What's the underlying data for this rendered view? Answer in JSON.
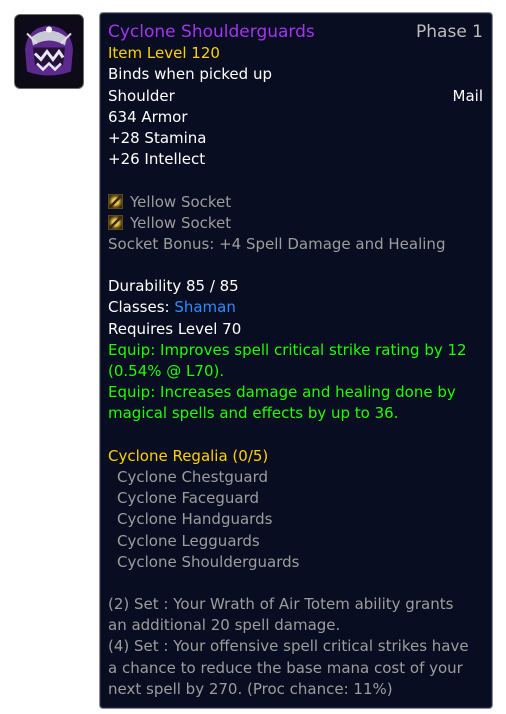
{
  "item": {
    "icon": "purple-helm-shoulder-icon",
    "name": "Cyclone Shoulderguards",
    "phase": "Phase 1",
    "item_level": "Item Level 120",
    "binds": "Binds when picked up",
    "slot": "Shoulder",
    "armor_type": "Mail",
    "armor": "634 Armor",
    "stats": [
      "+28 Stamina",
      "+26 Intellect"
    ],
    "sockets": [
      "Yellow Socket",
      "Yellow Socket"
    ],
    "socket_bonus": "Socket Bonus: +4 Spell Damage and Healing",
    "durability": "Durability 85 / 85",
    "classes_label": "Classes: ",
    "class_name": "Shaman",
    "requires": "Requires Level 70",
    "equip_lines": [
      "Equip: Improves spell critical strike rating by 12",
      "(0.54% @ L70).",
      "Equip: Increases damage and healing done by",
      "magical spells and effects by up to 36."
    ]
  },
  "set": {
    "title": "Cyclone Regalia (0/5)",
    "pieces": [
      "Cyclone Chestguard",
      "Cyclone Faceguard",
      "Cyclone Handguards",
      "Cyclone Legguards",
      "Cyclone Shoulderguards"
    ],
    "bonus_lines": [
      "(2) Set : Your Wrath of Air Totem ability grants",
      "an additional 20 spell damage.",
      "(4) Set : Your offensive spell critical strikes have",
      "a chance to reduce the base mana cost of your",
      "next spell by 270. (Proc chance: 11%)"
    ]
  },
  "colors": {
    "epic": "#a335ee",
    "gold": "#ffd100",
    "grey": "#9d9d9d",
    "green": "#1eff00",
    "class_shaman": "#2b8cff",
    "background": "#080d21"
  }
}
